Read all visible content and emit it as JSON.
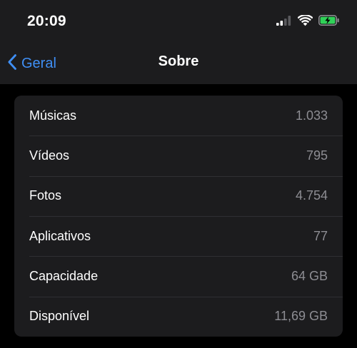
{
  "status_bar": {
    "time": "20:09",
    "icons": [
      "cellular-signal-icon",
      "wifi-icon",
      "battery-charging-icon"
    ]
  },
  "nav": {
    "back_label": "Geral",
    "title": "Sobre"
  },
  "colors": {
    "accent": "#3f8ff5",
    "battery_green": "#30d158",
    "background": "#000000",
    "card": "#1c1c1e",
    "value_text": "#8d8d93"
  },
  "rows": [
    {
      "label": "Músicas",
      "value": "1.033"
    },
    {
      "label": "Vídeos",
      "value": "795"
    },
    {
      "label": "Fotos",
      "value": "4.754"
    },
    {
      "label": "Aplicativos",
      "value": "77"
    },
    {
      "label": "Capacidade",
      "value": "64 GB"
    },
    {
      "label": "Disponível",
      "value": "11,69 GB"
    }
  ]
}
